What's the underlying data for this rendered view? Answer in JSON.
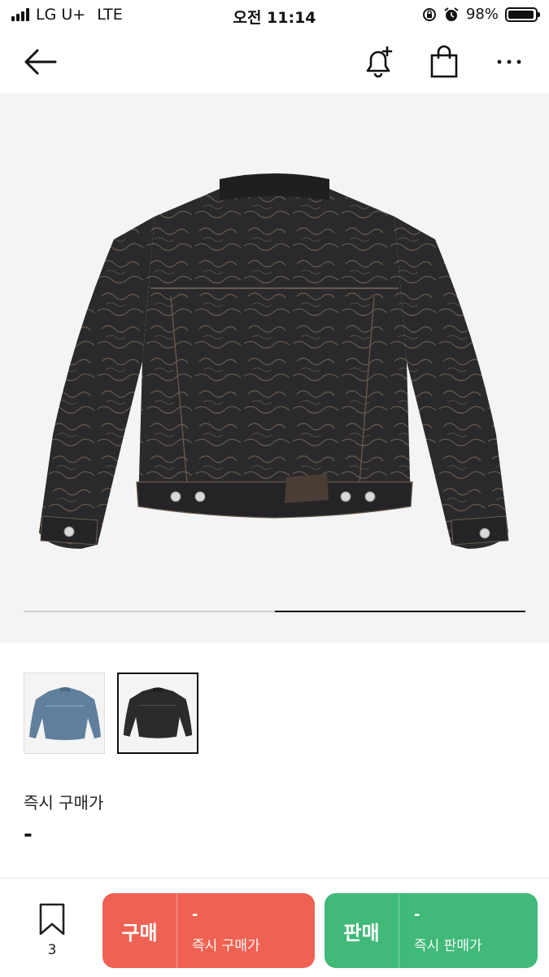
{
  "status_bar": {
    "carrier": "LG U+",
    "network": "LTE",
    "time": "오전 11:14",
    "battery": "98%",
    "battery_level": 0.98
  },
  "nav": {
    "back_icon": "arrow-left-icon",
    "bell_icon": "bell-plus-icon",
    "bag_icon": "shopping-bag-icon",
    "more_icon": "more-horizontal-icon"
  },
  "gallery": {
    "image_count": 2,
    "current_index": 2,
    "thumbnails": [
      {
        "name": "blue-denim-jacket",
        "selected": false
      },
      {
        "name": "black-denim-jacket",
        "selected": true
      }
    ]
  },
  "price": {
    "label": "즉시 구매가",
    "value": "-"
  },
  "bottom": {
    "wish_count": "3",
    "buy": {
      "label": "구매",
      "value": "-",
      "sublabel": "즉시 구매가",
      "color": "#ef6253"
    },
    "sell": {
      "label": "판매",
      "value": "-",
      "sublabel": "즉시 판매가",
      "color": "#41b979"
    }
  }
}
